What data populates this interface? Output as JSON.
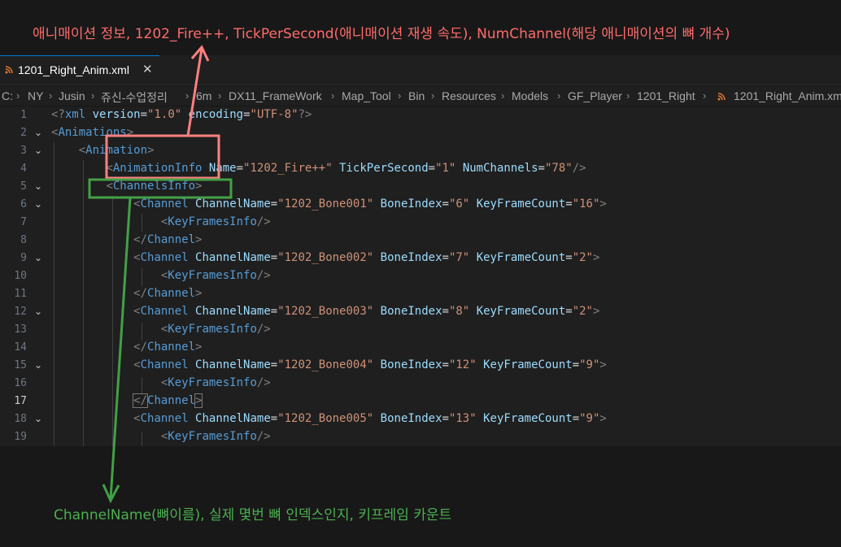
{
  "annotations": {
    "top": "애니매이션 정보, 1202_Fire++, TickPerSecond(애니매이션 재생 속도), NumChannel(해당 애니매이션의 뼈 개수)",
    "bottom": "ChannelName(뼈이름), 실제 몇번 뼈 인덱스인지, 키프레임 카운트",
    "colors": {
      "top": "#ff6b6b",
      "bottom": "#4caf50"
    }
  },
  "tab": {
    "label": "1201_Right_Anim.xml",
    "icon": "rss-icon",
    "close": "✕"
  },
  "breadcrumb": [
    "C:",
    "NY",
    "Jusin",
    "쥬신-수업정리",
    "6m",
    "DX11_FrameWork",
    "Map_Tool",
    "Bin",
    "Resources",
    "Models",
    "GF_Player",
    "1201_Right",
    "1201_Right_Anim.xml"
  ],
  "editor": {
    "line_numbers": [
      "1",
      "2",
      "3",
      "4",
      "5",
      "6",
      "7",
      "8",
      "9",
      "10",
      "11",
      "12",
      "13",
      "14",
      "15",
      "16",
      "17",
      "18",
      "19"
    ],
    "active_line": "17",
    "tokens": {
      "decl_open": "<?",
      "decl_name": "xml",
      "version_attr": "version",
      "version_val": "\"1.0\"",
      "encoding_attr": "encoding",
      "encoding_val": "\"UTF-8\"",
      "decl_close": "?>",
      "lt": "<",
      "gt": ">",
      "lt_close": "</",
      "self_close": "/>",
      "eq": "=",
      "animations": "Animations",
      "animation": "Animation",
      "animation_info": "AnimationInfo",
      "channels_info": "ChannelsInfo",
      "channel": "Channel",
      "keyframes_info": "KeyFramesInfo",
      "attr_name": "Name",
      "attr_tick": "TickPerSecond",
      "attr_numch": "NumChannels",
      "attr_chname": "ChannelName",
      "attr_boneidx": "BoneIndex",
      "attr_kfc": "KeyFrameCount"
    },
    "animation_info": {
      "name": "\"1202_Fire++\"",
      "tick": "\"1\"",
      "numch": "\"78\""
    },
    "channels": [
      {
        "name": "\"1202_Bone001\"",
        "bone": "\"6\"",
        "kfc": "\"16\""
      },
      {
        "name": "\"1202_Bone002\"",
        "bone": "\"7\"",
        "kfc": "\"2\""
      },
      {
        "name": "\"1202_Bone003\"",
        "bone": "\"8\"",
        "kfc": "\"2\""
      },
      {
        "name": "\"1202_Bone004\"",
        "bone": "\"12\"",
        "kfc": "\"9\""
      },
      {
        "name": "\"1202_Bone005\"",
        "bone": "\"13\"",
        "kfc": "\"9\""
      }
    ]
  }
}
